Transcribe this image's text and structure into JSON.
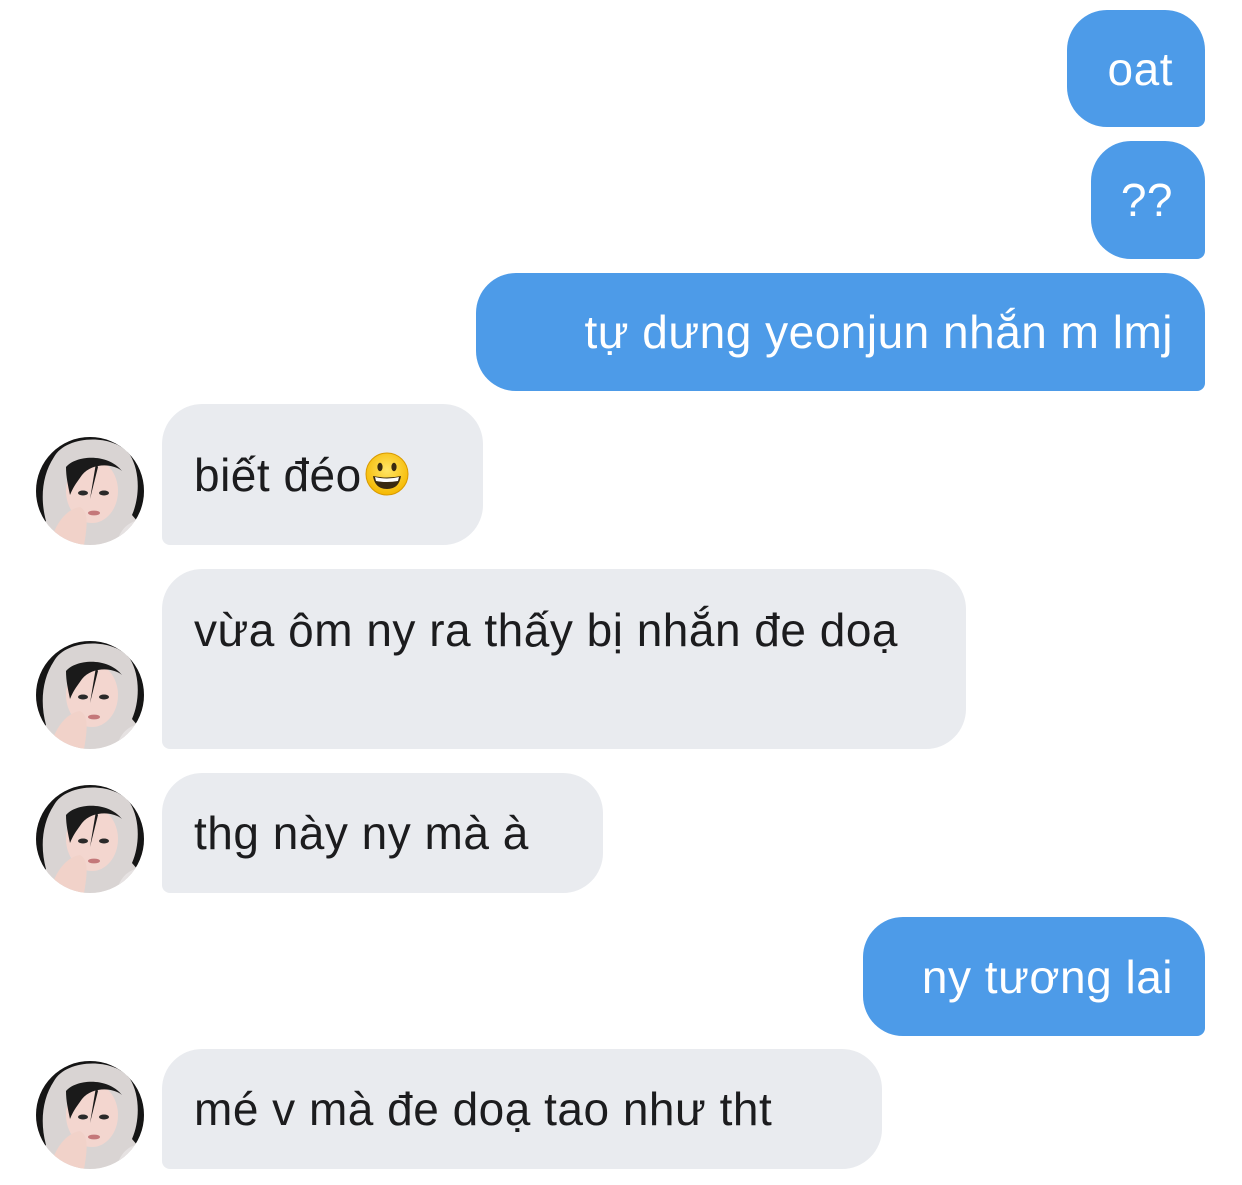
{
  "conversation": {
    "messages": [
      {
        "sender": "me",
        "text": "oat"
      },
      {
        "sender": "me",
        "text": "??"
      },
      {
        "sender": "me",
        "text": "tự dưng yeonjun nhắn m lmj"
      },
      {
        "sender": "them",
        "text": "biết đéo",
        "emoji": "grinning-face-emoji"
      },
      {
        "sender": "them",
        "text": "vừa ôm ny ra thấy bị nhắn đe doạ"
      },
      {
        "sender": "them",
        "text": "thg này ny mà à"
      },
      {
        "sender": "me",
        "text": "ny tương lai"
      },
      {
        "sender": "them",
        "text": "mé v mà đe doạ tao như tht"
      }
    ]
  },
  "colors": {
    "outgoing_bubble": "#4d9be8",
    "incoming_bubble": "#e9ebef",
    "outgoing_text": "#ffffff",
    "incoming_text": "#1c1c1e"
  },
  "icons": {
    "avatar": "profile-photo-avatar"
  }
}
